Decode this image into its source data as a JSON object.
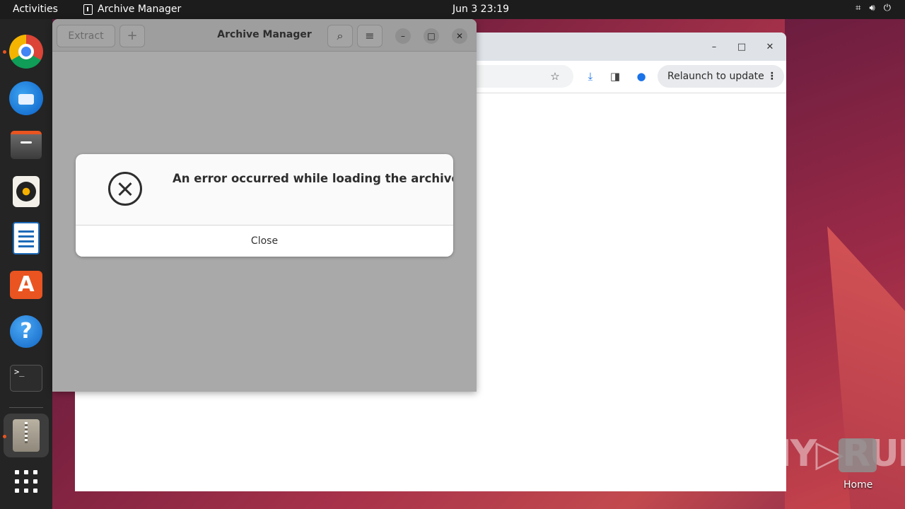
{
  "topbar": {
    "activities": "Activities",
    "app_name": "Archive Manager",
    "clock": "Jun 3  23:19",
    "tray_icons": [
      "network-icon",
      "volume-icon",
      "power-icon"
    ]
  },
  "dock": {
    "items": [
      "chrome",
      "thunderbird",
      "files",
      "rhythmbox",
      "libreoffice-writer",
      "app-center",
      "help",
      "terminal",
      "archive-manager",
      "show-apps"
    ]
  },
  "browser": {
    "window_controls": {
      "minimize": "–",
      "maximize": "□",
      "close": "✕"
    },
    "relaunch_label": "Relaunch to update",
    "relaunch_menu": "⋮"
  },
  "archive_manager": {
    "title": "Archive Manager",
    "extract_label": "Extract",
    "add_label": "+",
    "search_icon": "⌕",
    "menu_icon": "≡",
    "window_controls": {
      "minimize": "–",
      "maximize": "□",
      "close": "✕"
    }
  },
  "dialog": {
    "message": "An error occurred while loading the archive.",
    "close_label": "Close"
  },
  "desktop": {
    "watermark": "ANY▷RUN",
    "home_label": "Home"
  },
  "colors": {
    "accent": "#e95420",
    "topbar": "#1c1c1c",
    "dock": "#242424"
  }
}
